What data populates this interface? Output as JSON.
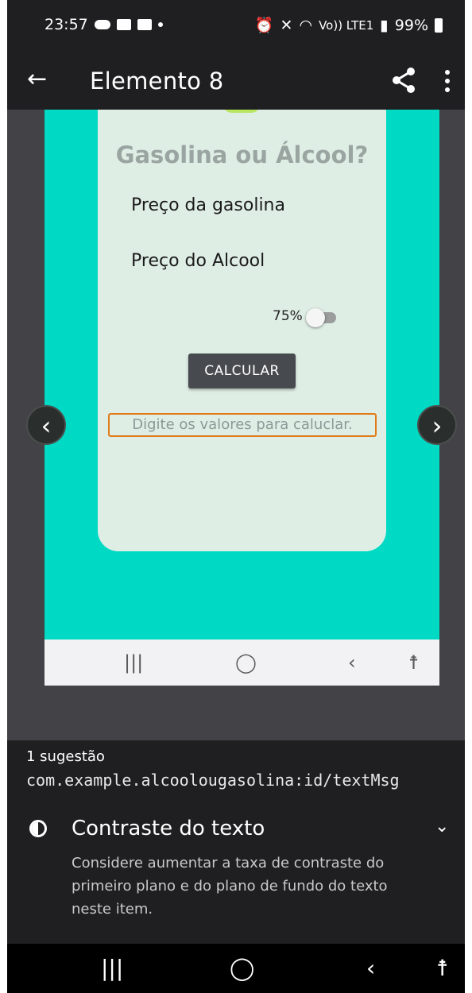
{
  "status_bar": {
    "time": "23:57",
    "network_label": "Vo)) LTE1",
    "battery": "99%"
  },
  "app_bar": {
    "title": "Elemento 8"
  },
  "screenshot": {
    "heading": "Gasolina ou Álcool?",
    "label_gas": "Preço da gasolina",
    "label_alcohol": "Preço do Alcool",
    "percent_label": "75%",
    "switch_on": false,
    "calc_button": "CALCULAR",
    "message": "Digite os valores para caluclar.",
    "highlight_color": "#e07b18",
    "background_color": "#00d9c4"
  },
  "suggestions": {
    "count_label": "1 sugestão",
    "resource_id": "com.example.alcoolougasolina:id/textMsg",
    "issue_title": "Contraste do texto",
    "issue_description": "Considere aumentar a taxa de contraste do primeiro plano e do plano de fundo do texto neste item."
  },
  "icons": {
    "back": "arrow-left",
    "share": "share-icon",
    "more": "more-vert-icon",
    "prev": "chevron-left-icon",
    "next": "chevron-right-icon",
    "contrast": "contrast-icon",
    "expand": "chevron-down-icon"
  }
}
